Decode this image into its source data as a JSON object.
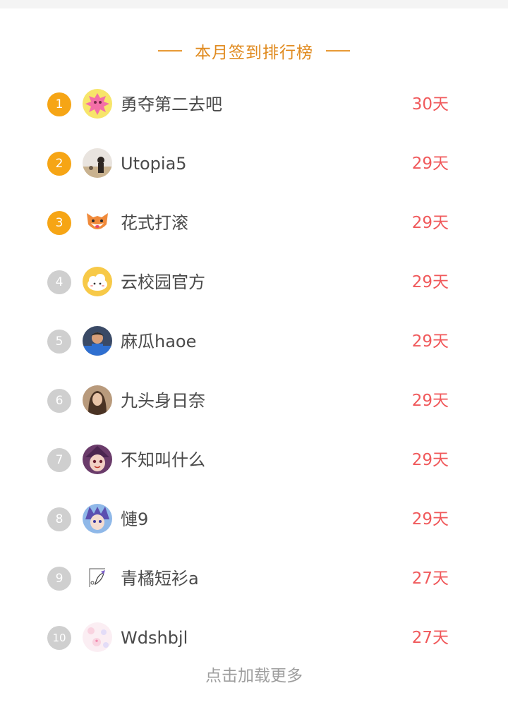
{
  "header": {
    "title": "本月签到排行榜"
  },
  "ranking": [
    {
      "rank": "1",
      "name": "勇夺第二去吧",
      "days": "30天",
      "avatar": "pink-splash-avatar"
    },
    {
      "rank": "2",
      "name": "Utopia5",
      "days": "29天",
      "avatar": "person-photo-avatar"
    },
    {
      "rank": "3",
      "name": "花式打滚",
      "days": "29天",
      "avatar": "fox-cartoon-avatar"
    },
    {
      "rank": "4",
      "name": "云校园官方",
      "days": "29天",
      "avatar": "cloud-mascot-avatar"
    },
    {
      "rank": "5",
      "name": "麻瓜haoe",
      "days": "29天",
      "avatar": "person-photo-avatar"
    },
    {
      "rank": "6",
      "name": "九头身日奈",
      "days": "29天",
      "avatar": "person-photo-avatar"
    },
    {
      "rank": "7",
      "name": "不知叫什么",
      "days": "29天",
      "avatar": "anime-girl-avatar"
    },
    {
      "rank": "8",
      "name": "慩9",
      "days": "29天",
      "avatar": "anime-boy-avatar"
    },
    {
      "rank": "9",
      "name": "青橘短衫a",
      "days": "27天",
      "avatar": "sketch-avatar"
    },
    {
      "rank": "10",
      "name": "Wdshbjl",
      "days": "27天",
      "avatar": "pastel-pattern-avatar"
    }
  ],
  "load_more": "点击加载更多",
  "colors": {
    "title": "#e08a1e",
    "rank_top": "#f6a515",
    "rank_other": "#cfcfcf",
    "days": "#f0595b",
    "name": "#4a4a4a",
    "load_more": "#9e9e9e"
  }
}
